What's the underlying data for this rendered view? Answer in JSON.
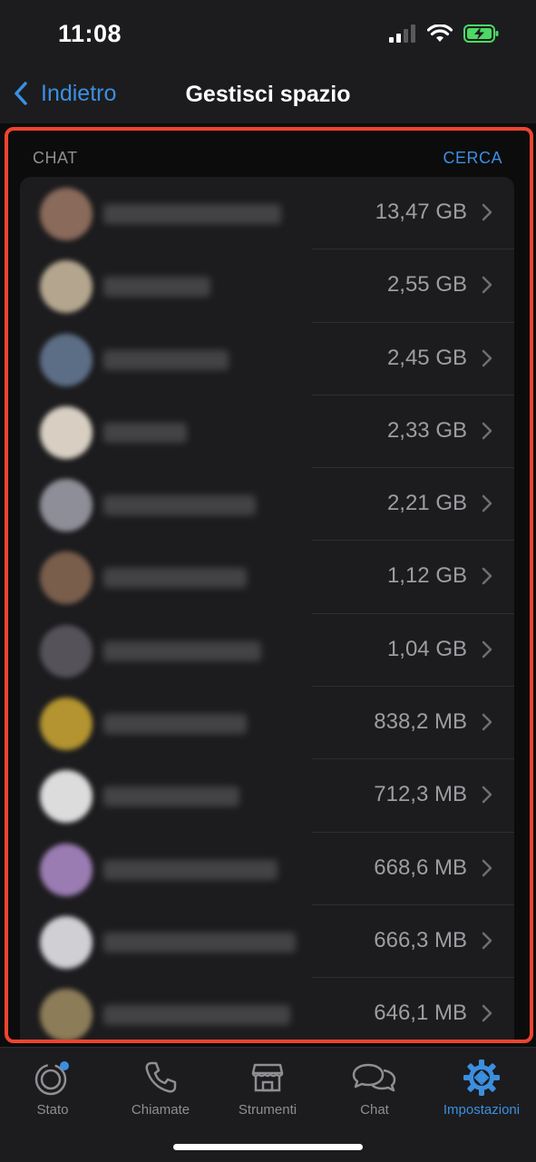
{
  "status_bar": {
    "time": "11:08",
    "battery_color": "#4cd964"
  },
  "nav": {
    "back_label": "Indietro",
    "title": "Gestisci spazio"
  },
  "section": {
    "header": "CHAT",
    "search_label": "CERCA"
  },
  "chats": [
    {
      "size": "13,47 GB",
      "avatar_color": "#8a6a5a"
    },
    {
      "size": "2,55 GB",
      "avatar_color": "#b4a68e"
    },
    {
      "size": "2,45 GB",
      "avatar_color": "#5c6e86"
    },
    {
      "size": "2,33 GB",
      "avatar_color": "#d8cfc2"
    },
    {
      "size": "2,21 GB",
      "avatar_color": "#8e8e98"
    },
    {
      "size": "1,12 GB",
      "avatar_color": "#7a5e4c"
    },
    {
      "size": "1,04 GB",
      "avatar_color": "#55525a"
    },
    {
      "size": "838,2 MB",
      "avatar_color": "#b49430"
    },
    {
      "size": "712,3 MB",
      "avatar_color": "#dcdcdc"
    },
    {
      "size": "668,6 MB",
      "avatar_color": "#9a7cb2"
    },
    {
      "size": "666,3 MB",
      "avatar_color": "#cfcfd4"
    },
    {
      "size": "646,1 MB",
      "avatar_color": "#8c7c58"
    }
  ],
  "tabs": [
    {
      "label": "Stato",
      "icon": "status-icon"
    },
    {
      "label": "Chiamate",
      "icon": "phone-icon"
    },
    {
      "label": "Strumenti",
      "icon": "store-icon"
    },
    {
      "label": "Chat",
      "icon": "chat-bubbles-icon"
    },
    {
      "label": "Impostazioni",
      "icon": "gear-icon",
      "active": true
    }
  ],
  "colors": {
    "accent": "#3b8fe0",
    "highlight_border": "#ee4430"
  }
}
